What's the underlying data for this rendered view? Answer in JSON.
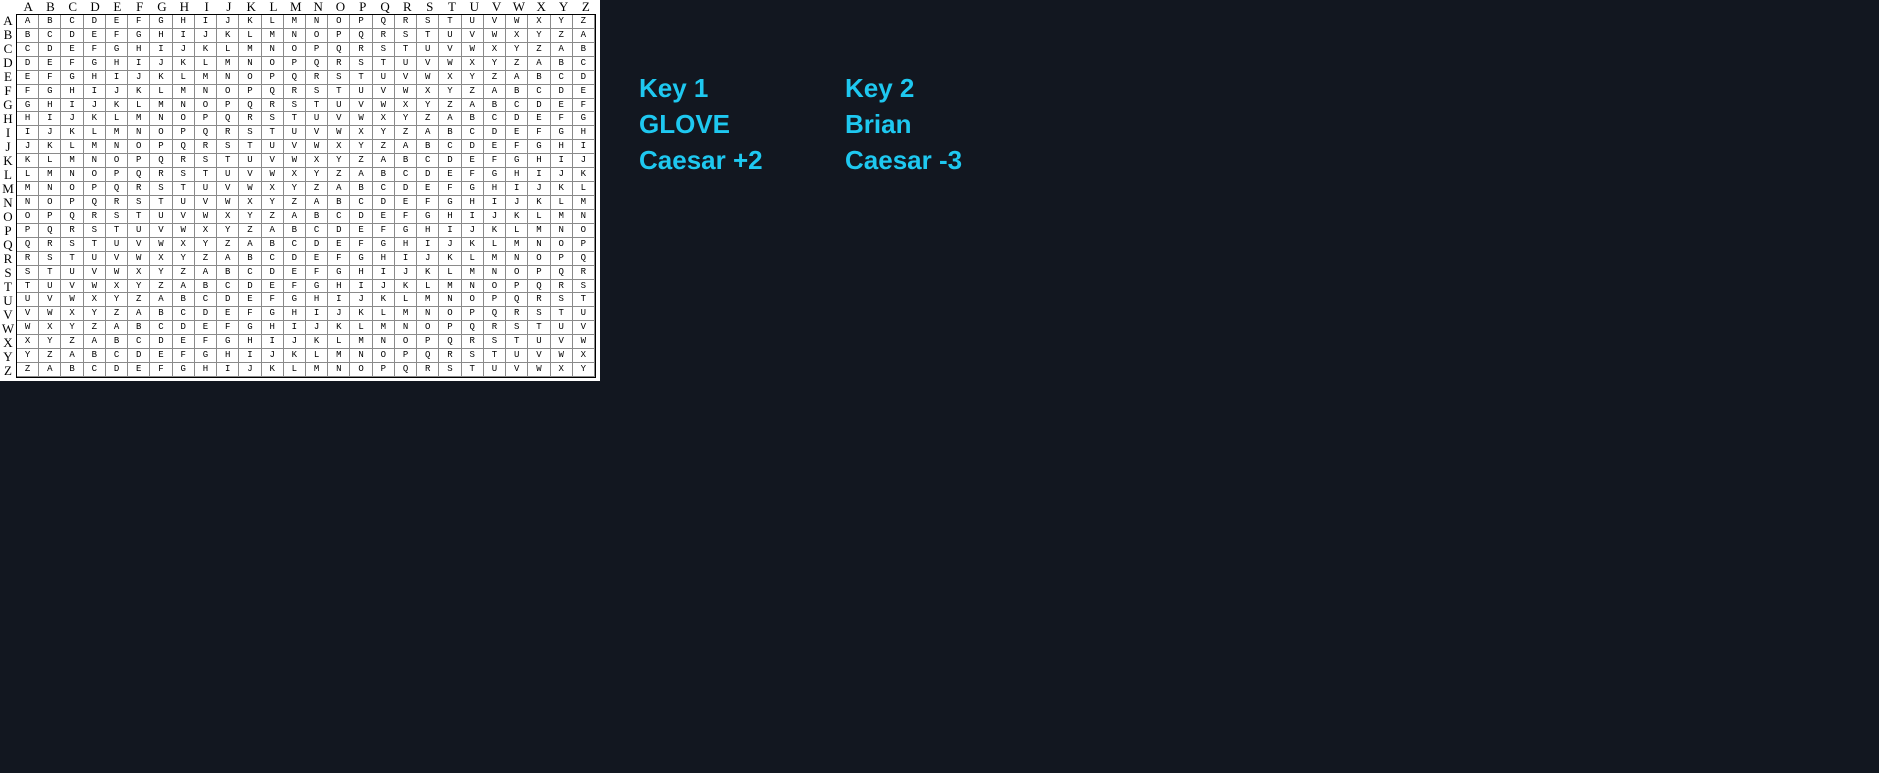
{
  "colors": {
    "background": "#121720",
    "note_text": "#1ec8f0",
    "square_background": "#ffffff",
    "square_text": "#000000"
  },
  "square": {
    "column_headers": [
      "A",
      "B",
      "C",
      "D",
      "E",
      "F",
      "G",
      "H",
      "I",
      "J",
      "K",
      "L",
      "M",
      "N",
      "O",
      "P",
      "Q",
      "R",
      "S",
      "T",
      "U",
      "V",
      "W",
      "X",
      "Y",
      "Z"
    ],
    "row_headers": [
      "A",
      "B",
      "C",
      "D",
      "E",
      "F",
      "G",
      "H",
      "I",
      "J",
      "K",
      "L",
      "M",
      "N",
      "O",
      "P",
      "Q",
      "R",
      "S",
      "T",
      "U",
      "V",
      "W",
      "X",
      "Y",
      "Z"
    ],
    "rows": [
      "ABCDEFGHIJKLMNOPQRSTUVWXYZ",
      "BCDEFGHIJKLMNOPQRSTUVWXYZA",
      "CDEFGHIJKLMNOPQRSTUVWXYZAB",
      "DEFGHIJKLMNOPQRSTUVWXYZABC",
      "EFGHIJKLMNOPQRSTUVWXYZABCD",
      "FGHIJKLMNOPQRSTUVWXYZABCDE",
      "GHIJKLMNOPQRSTUVWXYZABCDEF",
      "HIJKLMNOPQRSTUVWXYZABCDEFG",
      "IJKLMNOPQRSTUVWXYZABCDEFGH",
      "JKLMNOPQRSTUVWXYZABCDEFGHI",
      "KLMNOPQRSTUVWXYZABCDEFGHIJ",
      "LMNOPQRSTUVWXYZABCDEFGHIJK",
      "MNOPQRSTUVWXYZABCDEFGHIJKL",
      "NOPQRSTUVWXYZABCDEFGHIJKLM",
      "OPQRSTUVWXYZABCDEFGHIJKLMN",
      "PQRSTUVWXYZABCDEFGHIJKLMNO",
      "QRSTUVWXYZABCDEFGHIJKLMNOP",
      "RSTUVWXYZABCDEFGHIJKLMNOPQ",
      "STUVWXYZABCDEFGHIJKLMNOPQR",
      "TUVWXYZABCDEFGHIJKLMNOPQRS",
      "UVWXYZABCDEFGHIJKLMNOPQRST",
      "VWXYZABCDEFGHIJKLMNOPQRSTU",
      "WXYZABCDEFGHIJKLMNOPQRSTUV",
      "XYZABCDEFGHIJKLMNOPQRSTUVW",
      "YZABCDEFGHIJKLMNOPQRSTUVWX",
      "ZABCDEFGHIJKLMNOPQRSTUVWXY"
    ]
  },
  "keys": {
    "key1": {
      "label": "Key 1",
      "word": "GLOVE",
      "shift": "Caesar +2"
    },
    "key2": {
      "label": "Key 2",
      "word": "Brian",
      "shift": "Caesar -3"
    }
  }
}
